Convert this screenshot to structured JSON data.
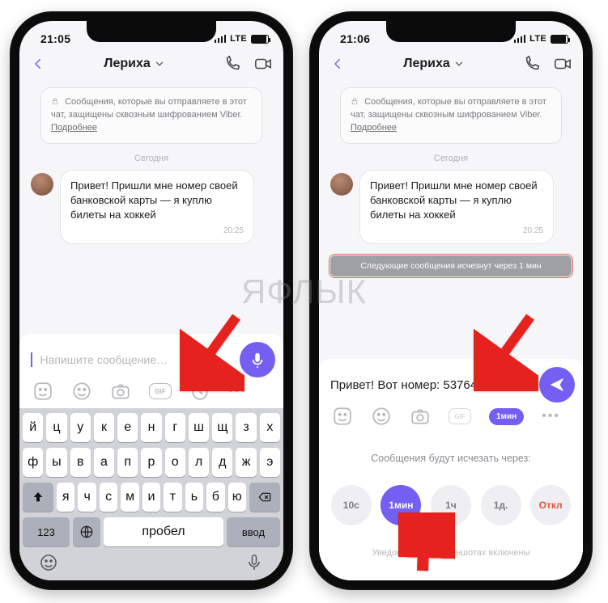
{
  "watermark": "ЯФЛЫК",
  "left": {
    "status": {
      "time": "21:05",
      "carrier": "LTE"
    },
    "header": {
      "title": "Лериха"
    },
    "encryption": {
      "text": "Сообщения, которые вы отправляете в этот чат, защищены сквозным шифрованием Viber.",
      "more": "Подробнее"
    },
    "day_label": "Сегодня",
    "message": {
      "text": "Привет! Пришли мне номер своей банковской карты — я куплю билеты на хоккей",
      "time": "20:25"
    },
    "input": {
      "placeholder": "Напишите сообщение…"
    },
    "keyboard": {
      "row1": [
        "й",
        "ц",
        "у",
        "к",
        "е",
        "н",
        "г",
        "ш",
        "щ",
        "з",
        "х"
      ],
      "row2": [
        "ф",
        "ы",
        "в",
        "а",
        "п",
        "р",
        "о",
        "л",
        "д",
        "ж",
        "э"
      ],
      "row3": [
        "я",
        "ч",
        "с",
        "м",
        "и",
        "т",
        "ь",
        "б",
        "ю"
      ],
      "numkey": "123",
      "space": "Пробел",
      "enter": "Ввод"
    }
  },
  "right": {
    "status": {
      "time": "21:06",
      "carrier": "LTE"
    },
    "header": {
      "title": "Лериха"
    },
    "encryption": {
      "text": "Сообщения, которые вы отправляете в этот чат, защищены сквозным шифрованием Viber.",
      "more": "Подробнее"
    },
    "day_label": "Сегодня",
    "message": {
      "text": "Привет! Пришли мне номер своей банковской карты — я куплю билеты на хоккей",
      "time": "20:25"
    },
    "banner": "Следующие сообщения исчезнут через 1 мин",
    "input": {
      "value": "Привет! Вот номер: 5376434788"
    },
    "timer_pill": "1мин",
    "timer_panel": {
      "label": "Сообщения будут исчезать через:",
      "options": [
        "10с",
        "1мин",
        "1ч",
        "1д.",
        "Откл"
      ],
      "active_index": 1,
      "footnote": "Уведомления о скриншотах включены"
    }
  }
}
